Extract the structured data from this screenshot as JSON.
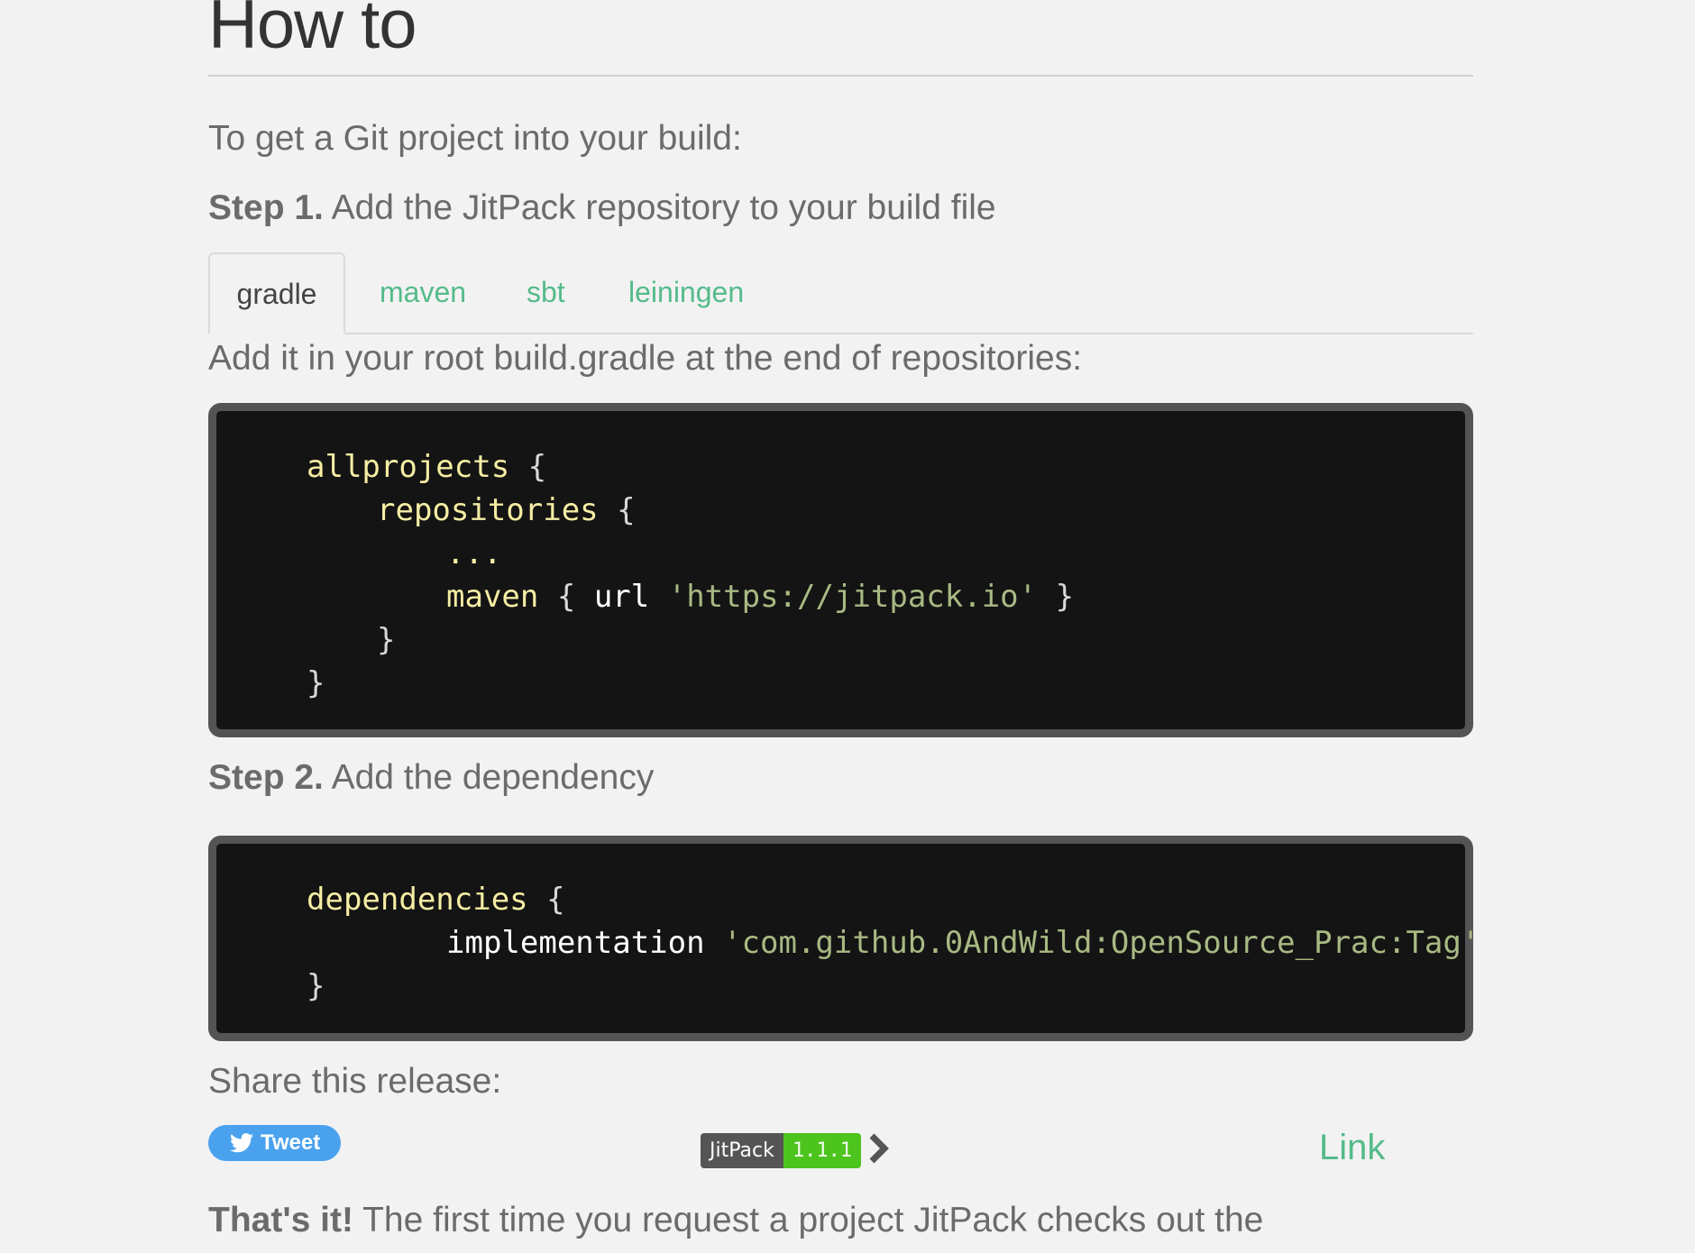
{
  "heading": "How to",
  "intro": "To get a Git project into your build:",
  "step1": {
    "label": "Step 1.",
    "text": "Add the JitPack repository to your build file"
  },
  "tabs": [
    {
      "label": "gradle",
      "active": true
    },
    {
      "label": "maven",
      "active": false
    },
    {
      "label": "sbt",
      "active": false
    },
    {
      "label": "leiningen",
      "active": false
    }
  ],
  "tab_hint": "Add it in your root build.gradle at the end of repositories:",
  "code1": {
    "allprojects": "allprojects",
    "repositories": "repositories",
    "ellipsis": "...",
    "maven": "maven",
    "url": "url",
    "url_value": "'https://jitpack.io'",
    "open_brace": "{",
    "close_brace": "}"
  },
  "step2": {
    "label": "Step 2.",
    "text": "Add the dependency"
  },
  "code2": {
    "dependencies": "dependencies",
    "implementation": "implementation",
    "artifact": "'com.github.0AndWild:OpenSource_Prac:Tag'",
    "open_brace": "{",
    "close_brace": "}"
  },
  "share_label": "Share this release:",
  "tweet_label": "Tweet",
  "badge": {
    "left": "JitPack",
    "right": "1.1.1"
  },
  "link_label": "Link",
  "outro": {
    "label": "That's it!",
    "text": "The first time you request a project JitPack checks out the"
  },
  "colors": {
    "accent": "#55bb8a",
    "code_bg": "#141414",
    "code_border": "#545454",
    "keyword": "#f5eda3",
    "string": "#a9b983",
    "tweet": "#4aa2ee",
    "badge_version": "#4dc41d"
  },
  "icons": {
    "tweet": "twitter-bird-icon",
    "badge": "chevron-right-icon"
  }
}
